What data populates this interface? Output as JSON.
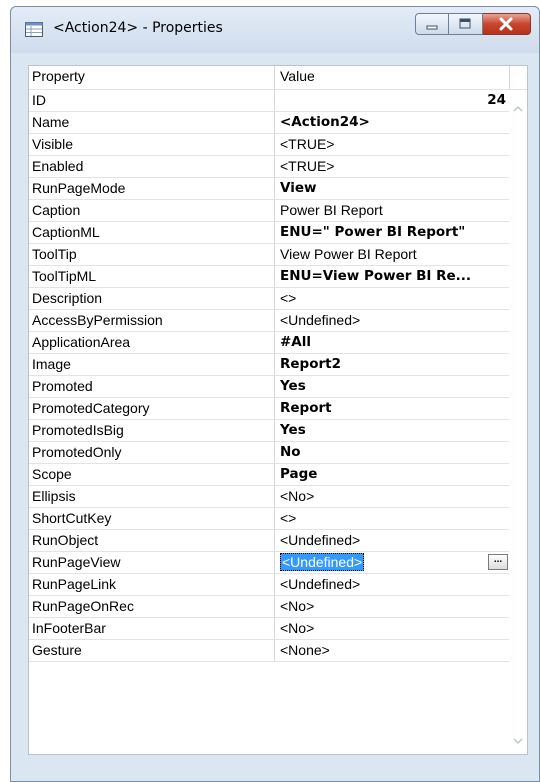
{
  "window": {
    "title": "<Action24> - Properties",
    "icon": "properties-grid-icon"
  },
  "grid": {
    "headers": {
      "property": "Property",
      "value": "Value"
    },
    "rows": [
      {
        "name": "ID",
        "value": "24",
        "bold": true,
        "align": "right"
      },
      {
        "name": "Name",
        "value": "<Action24>",
        "bold": true
      },
      {
        "name": "Visible",
        "value": "<TRUE>",
        "bold": false
      },
      {
        "name": "Enabled",
        "value": "<TRUE>",
        "bold": false
      },
      {
        "name": "RunPageMode",
        "value": "View",
        "bold": true
      },
      {
        "name": "Caption",
        "value": "Power BI Report",
        "bold": false
      },
      {
        "name": "CaptionML",
        "value": "ENU=\" Power BI Report\"",
        "bold": true
      },
      {
        "name": "ToolTip",
        "value": "View Power BI Report",
        "bold": false
      },
      {
        "name": "ToolTipML",
        "value": "ENU=View Power BI Re...",
        "bold": true
      },
      {
        "name": "Description",
        "value": "<>",
        "bold": false
      },
      {
        "name": "AccessByPermission",
        "value": "<Undefined>",
        "bold": false
      },
      {
        "name": "ApplicationArea",
        "value": "#All",
        "bold": true
      },
      {
        "name": "Image",
        "value": "Report2",
        "bold": true
      },
      {
        "name": "Promoted",
        "value": "Yes",
        "bold": true
      },
      {
        "name": "PromotedCategory",
        "value": "Report",
        "bold": true
      },
      {
        "name": "PromotedIsBig",
        "value": "Yes",
        "bold": true
      },
      {
        "name": "PromotedOnly",
        "value": "No",
        "bold": true
      },
      {
        "name": "Scope",
        "value": "Page",
        "bold": true
      },
      {
        "name": "Ellipsis",
        "value": "<No>",
        "bold": false
      },
      {
        "name": "ShortCutKey",
        "value": "<>",
        "bold": false
      },
      {
        "name": "RunObject",
        "value": "<Undefined>",
        "bold": false
      },
      {
        "name": "RunPageView",
        "value": "<Undefined>",
        "bold": false,
        "selected": true,
        "assist_button": "..."
      },
      {
        "name": "RunPageLink",
        "value": "<Undefined>",
        "bold": false
      },
      {
        "name": "RunPageOnRec",
        "value": "<No>",
        "bold": false
      },
      {
        "name": "InFooterBar",
        "value": "<No>",
        "bold": false
      },
      {
        "name": "Gesture",
        "value": "<None>",
        "bold": false
      }
    ]
  },
  "colors": {
    "selection": "#3399ff",
    "close_button": "#c7462e",
    "window_frame": "#dbe6f3"
  }
}
